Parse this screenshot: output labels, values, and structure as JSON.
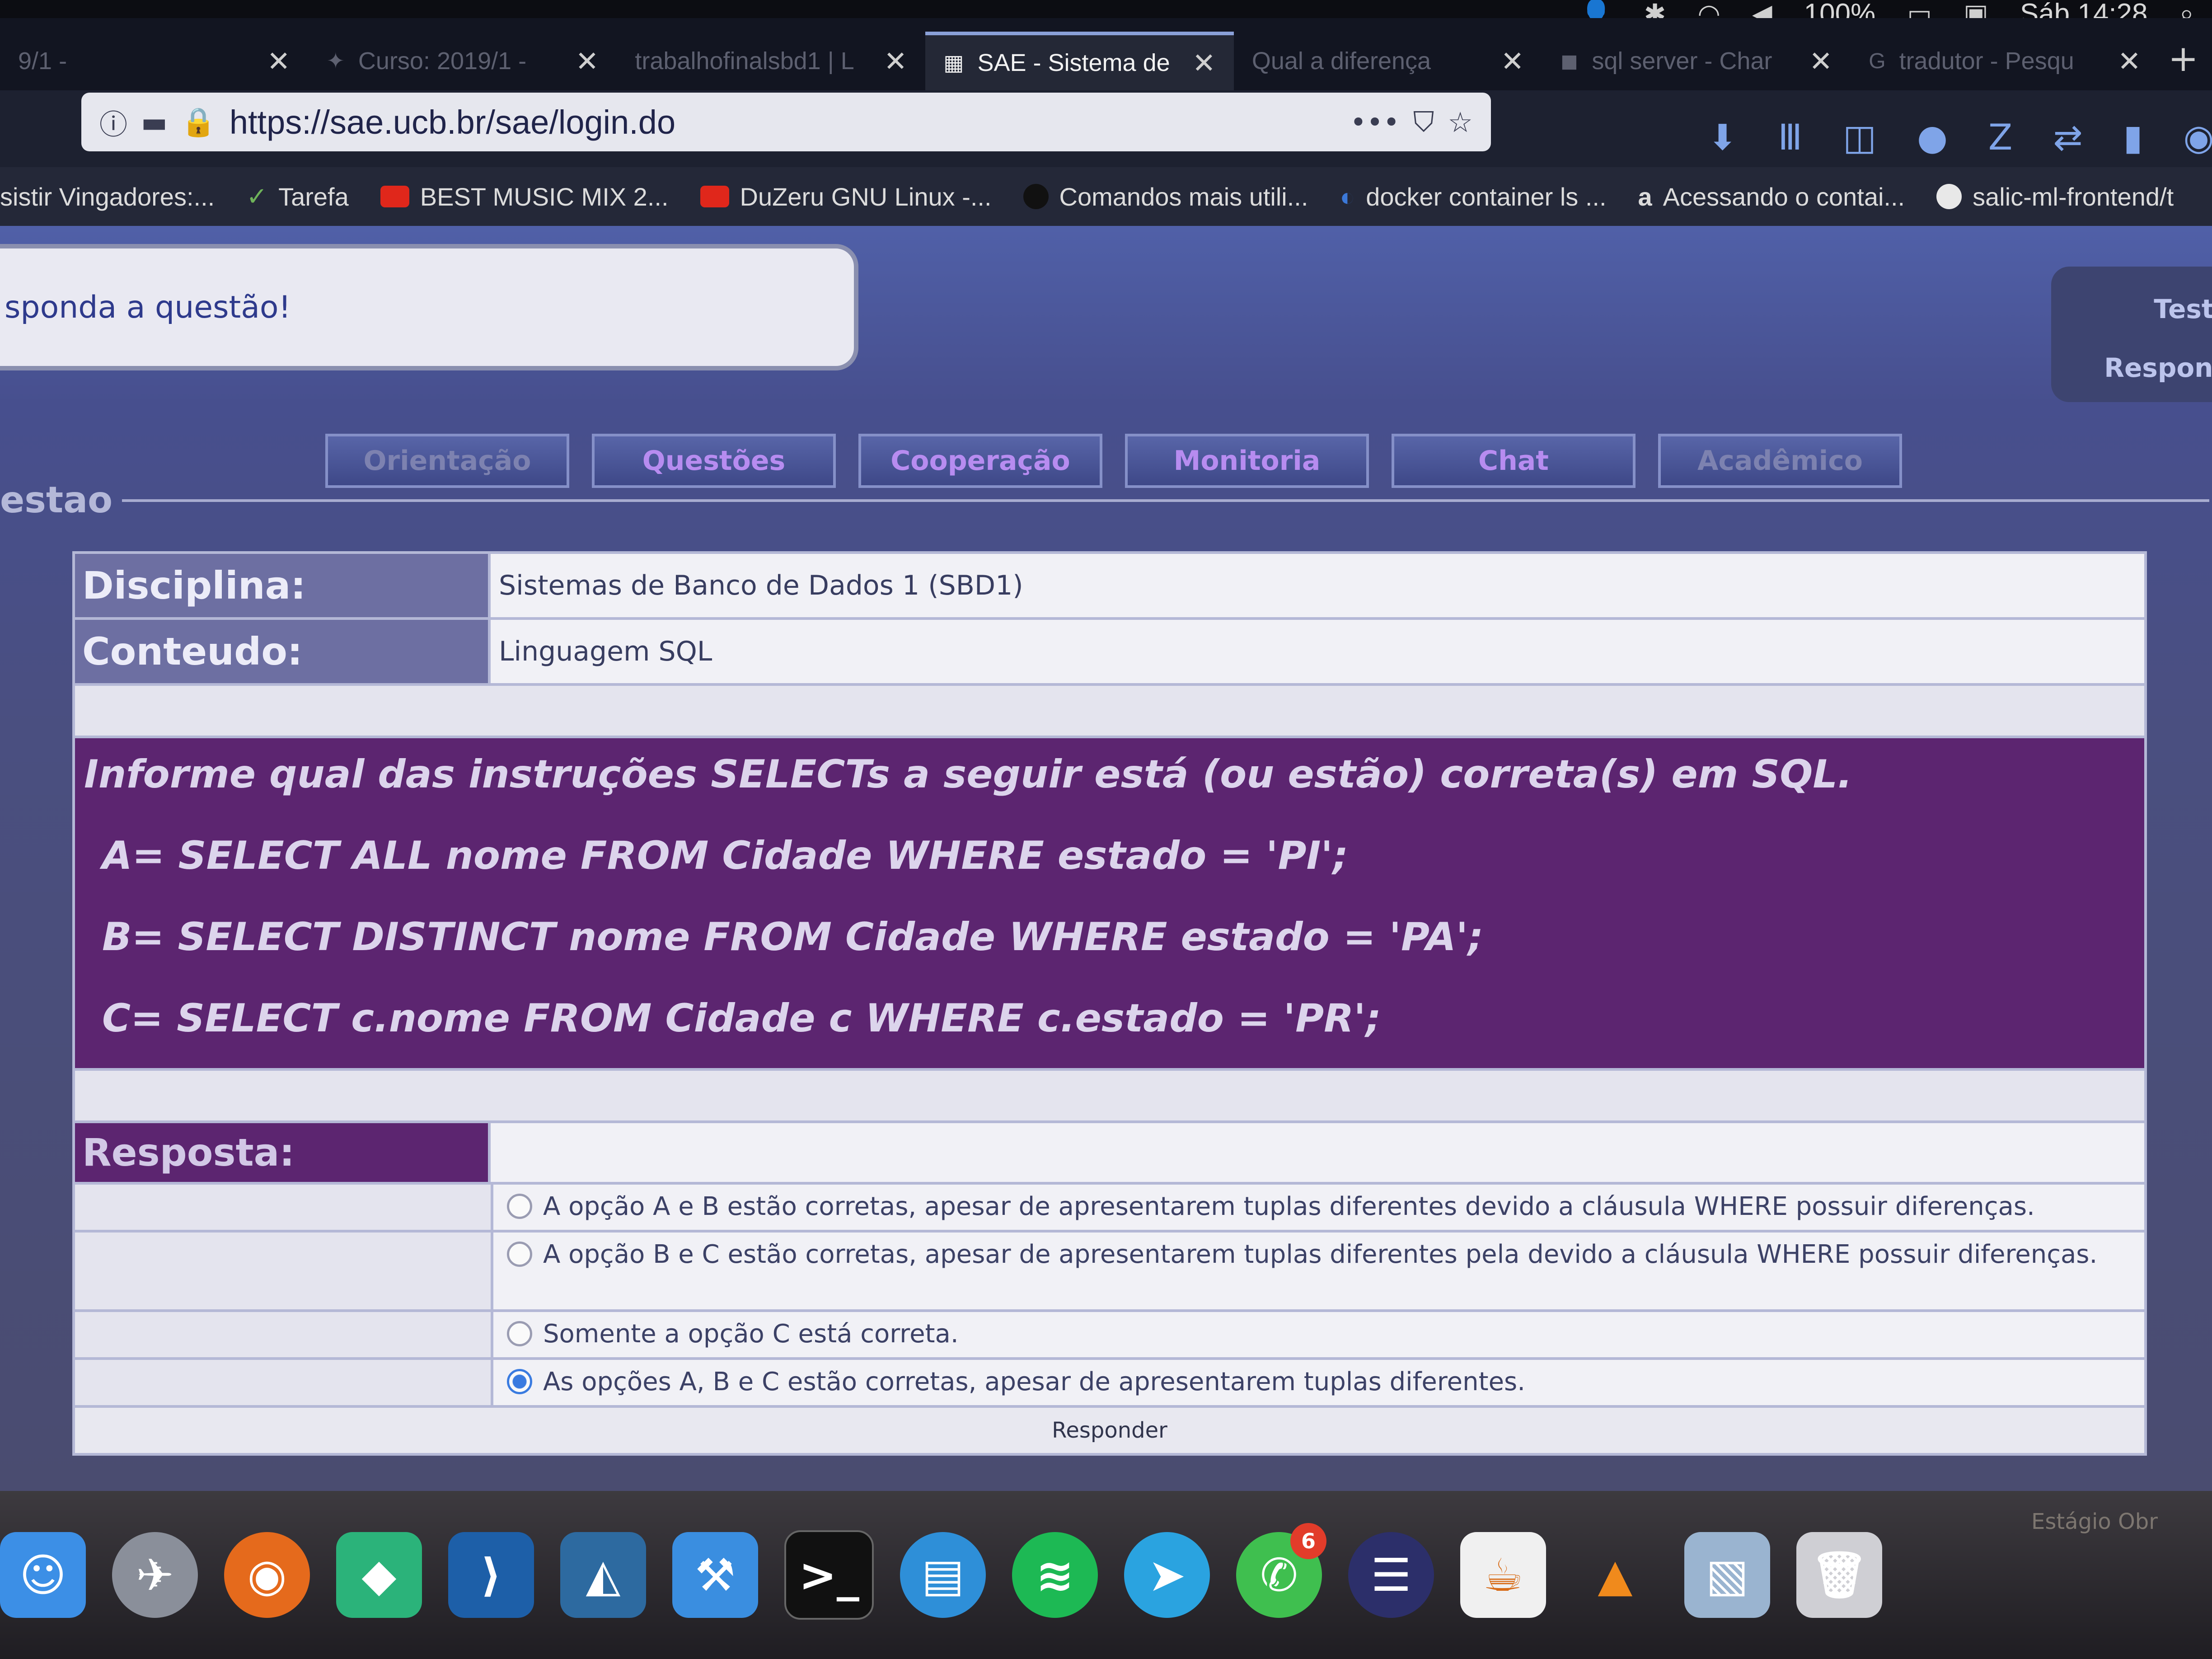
{
  "menubar": {
    "battery": "100%",
    "clock": "Sáb 14:28"
  },
  "browser": {
    "tabs": [
      {
        "label": "9/1 -",
        "active": false
      },
      {
        "label": "Curso: 2019/1 -",
        "active": false
      },
      {
        "label": "trabalhofinalsbd1 | L",
        "active": false
      },
      {
        "label": "SAE - Sistema de",
        "active": true
      },
      {
        "label": "Qual a diferença",
        "active": false
      },
      {
        "label": "sql server - Char",
        "active": false
      },
      {
        "label": "tradutor - Pesqu",
        "active": false
      }
    ],
    "close_glyph": "✕",
    "new_tab_glyph": "+",
    "url": "https://sae.ucb.br/sae/login.do",
    "bookmarks": [
      {
        "label": "sistir Vingadores:...",
        "icon": "none"
      },
      {
        "label": "Tarefa",
        "icon": "leaf-icon"
      },
      {
        "label": "BEST MUSIC MIX 2...",
        "icon": "youtube-icon"
      },
      {
        "label": "DuZeru GNU Linux -...",
        "icon": "youtube-icon"
      },
      {
        "label": "Comandos mais utili...",
        "icon": "dot-icon"
      },
      {
        "label": "docker container ls ...",
        "icon": "docker-icon"
      },
      {
        "label": "Acessando o contai...",
        "icon": "a-icon"
      },
      {
        "label": "salic-ml-frontend/t",
        "icon": "github-icon"
      }
    ]
  },
  "page": {
    "message": "sponda a questão!",
    "side_links": [
      "Teste",
      "Respond"
    ],
    "nav_tabs": [
      "Orientação",
      "Questões",
      "Cooperação",
      "Monitoria",
      "Chat",
      "Acadêmico"
    ],
    "section_title": "estao",
    "disciplina_label": "Disciplina:",
    "disciplina_value": "Sistemas de Banco de Dados 1 (SBD1)",
    "conteudo_label": "Conteudo:",
    "conteudo_value": "Linguagem SQL",
    "question": {
      "text": "Informe qual das instruções SELECTs a seguir está (ou estão) correta(s) em SQL.",
      "statements": [
        "A= SELECT ALL nome FROM Cidade WHERE estado = 'PI';",
        "B= SELECT DISTINCT nome FROM Cidade WHERE estado = 'PA';",
        "C= SELECT c.nome FROM Cidade c WHERE c.estado = 'PR';"
      ]
    },
    "answer_label": "Resposta:",
    "options": [
      "A opção A e B estão corretas, apesar de apresentarem tuplas diferentes devido a cláusula WHERE possuir diferenças.",
      "A opção B e C estão corretas, apesar de apresentarem tuplas diferentes pela devido a cláusula WHERE possuir diferenças.",
      "Somente a opção C está correta.",
      "As opções A, B e C estão corretas, apesar de apresentarem tuplas diferentes."
    ],
    "selected_option": 3,
    "submit_label": "Responder"
  },
  "dock": {
    "apps": [
      "Finder",
      "Launchpad",
      "Firefox",
      "Android Studio",
      "VS Code",
      "MySQL Workbench",
      "Xcode",
      "Terminal",
      "Docker",
      "Spotify",
      "Telegram",
      "WhatsApp",
      "Eclipse",
      "Java",
      "VLC",
      "Preview",
      "Trash"
    ],
    "whatsapp_badge": "6",
    "label": "Estágio Obr"
  },
  "colors": {
    "question_bg": "#5c2570",
    "label_bg": "#6d6fa2",
    "tab_text": "#b78cf0"
  }
}
